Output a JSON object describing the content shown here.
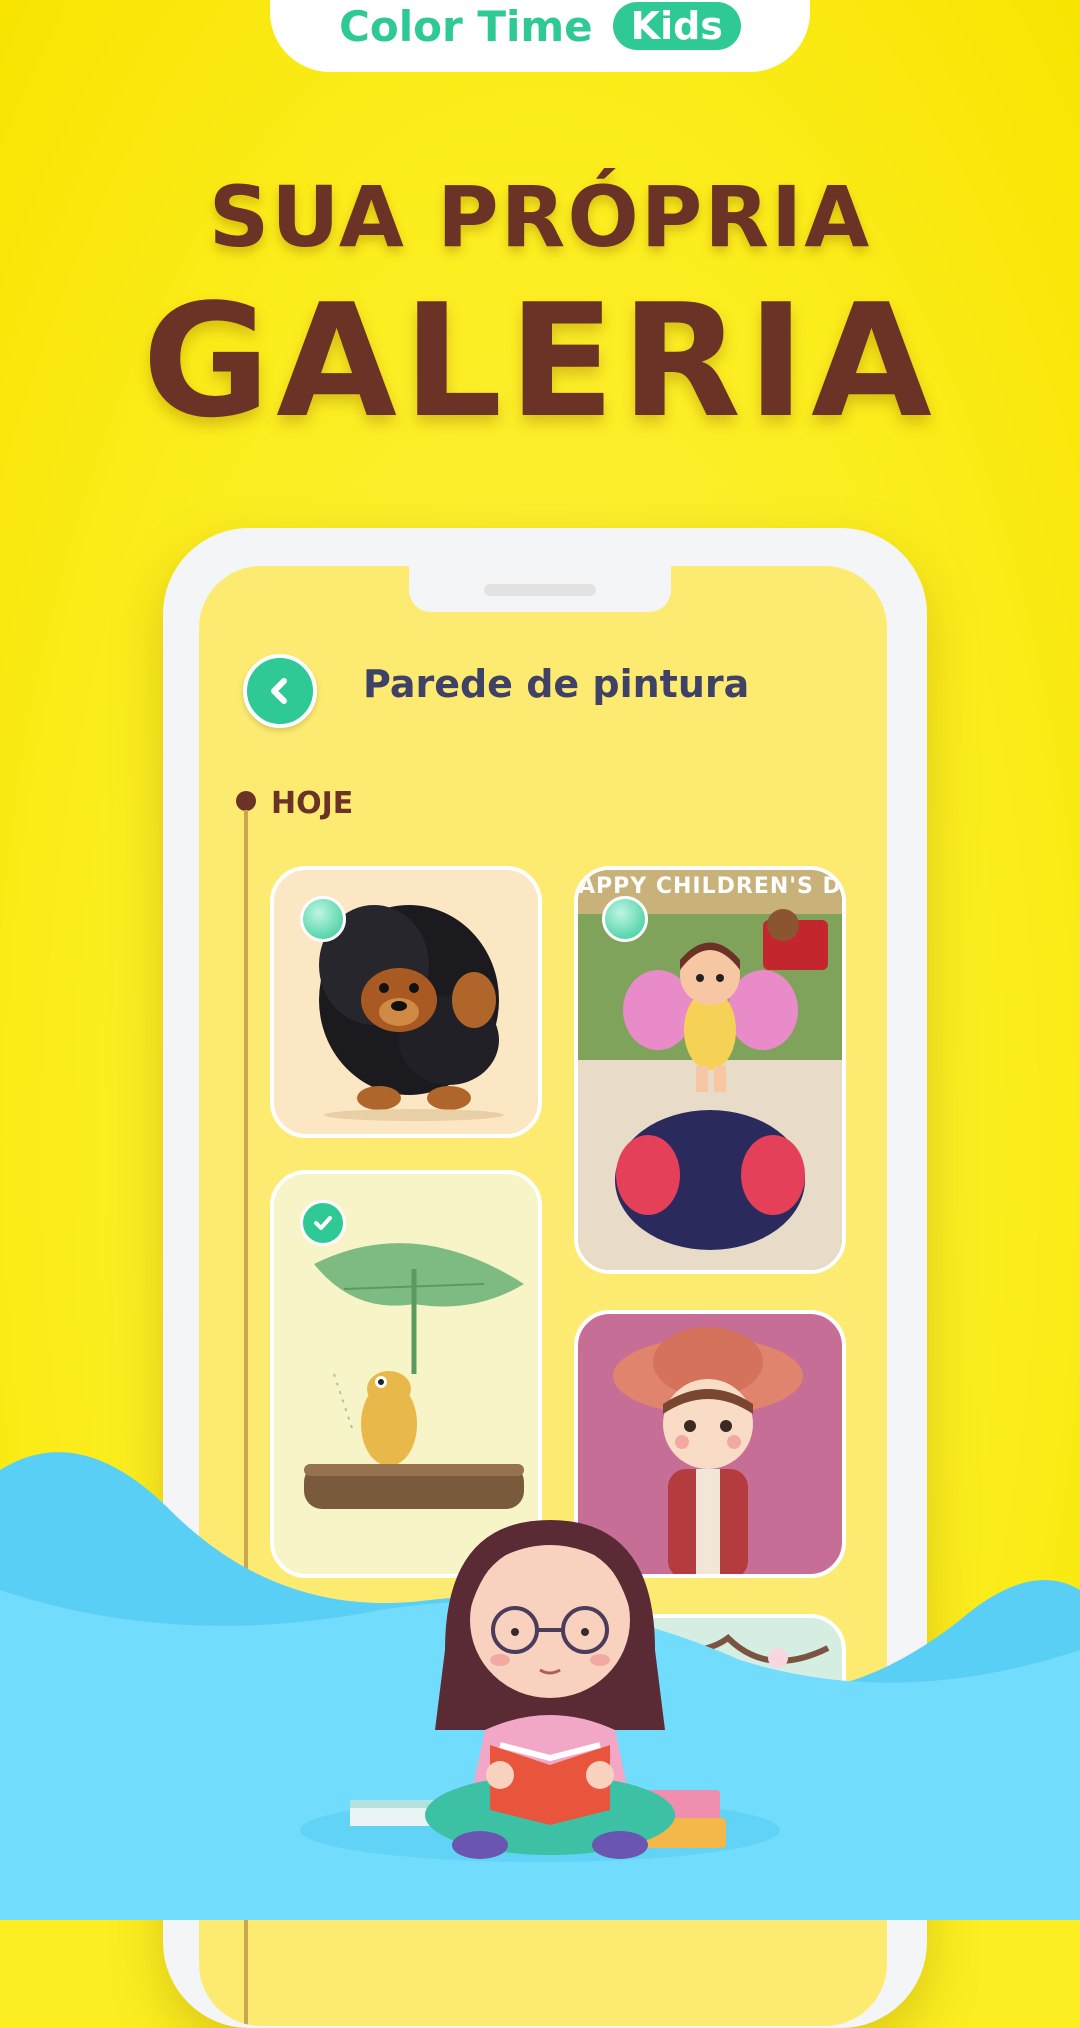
{
  "brand": {
    "name": "Color Time",
    "badge": "Kids"
  },
  "headline": {
    "line1": "SUA PRÓPRIA",
    "line2": "GALERIA"
  },
  "app": {
    "title": "Parede de pintura",
    "section": "HOJE",
    "cards": [
      {
        "name": "dog-artwork",
        "state": "unselected"
      },
      {
        "name": "butterfly-girl-artwork",
        "state": "unselected",
        "banner": "APPY CHILDREN'S DA"
      },
      {
        "name": "frog-artwork",
        "state": "selected"
      },
      {
        "name": "girl-hat-artwork",
        "state": "none"
      },
      {
        "name": "clouds-artwork",
        "state": "none"
      },
      {
        "name": "blossom-artwork",
        "state": "none"
      }
    ]
  },
  "colors": {
    "accent": "#2FC996",
    "brown": "#6B3326",
    "yellow": "#FCEE21",
    "screen": "#FDEB71",
    "sky": "#5ACFF5"
  },
  "icons": [
    "chevron-left-icon",
    "check-icon"
  ]
}
